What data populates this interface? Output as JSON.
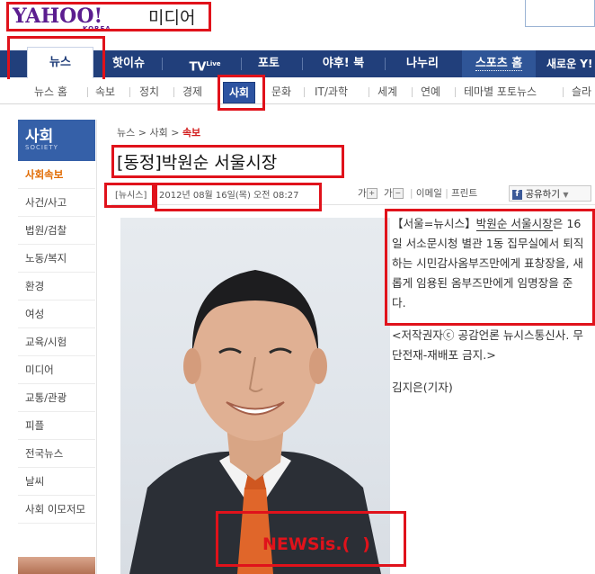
{
  "header": {
    "logo_text": "YAHOO!",
    "logo_sub": "KOREA",
    "section_name": "미디어"
  },
  "main_nav": [
    "뉴스",
    "핫이슈",
    "TV",
    "포토",
    "야후! 북",
    "나누리",
    "스포츠 홈",
    "새로운 Y!"
  ],
  "main_nav_tv_sup": "Live",
  "sub_nav": [
    "뉴스 홈",
    "속보",
    "정치",
    "경제",
    "사회",
    "문화",
    "IT/과학",
    "세계",
    "연예",
    "테마별 포토뉴스",
    "슬라"
  ],
  "sidebar": {
    "title": "사회",
    "subtitle": "SOCIETY",
    "items": [
      "사회속보",
      "사건/사고",
      "법원/검찰",
      "노동/복지",
      "환경",
      "여성",
      "교육/시험",
      "미디어",
      "교통/관광",
      "피플",
      "전국뉴스",
      "날씨",
      "사회 이모저모"
    ]
  },
  "breadcrumb": {
    "items": [
      "뉴스",
      "사회"
    ],
    "current": "속보",
    "separator": ">"
  },
  "article": {
    "title": "[동정]박원순 서울시장",
    "source": "[뉴시스]",
    "date": "2012년 08월 16일(목) 오전 08:27",
    "tools": {
      "font_up": "가",
      "font_down": "가",
      "email": "이메일",
      "print": "프린트",
      "share": "공유하기"
    },
    "body_lead_source": "【서울=뉴시스】",
    "body_lead_name": "박원순 서울시장",
    "body_lead_rest": "은 16일 서소문시청 별관 1동 집무실에서 퇴직하는 시민감사옴부즈만에게 표창장을, 새롭게 임용된 옴부즈만에게 임명장을 준다.",
    "copyright": "<저작권자ⓒ 공감언론 뉴시스통신사. 무단전재-재배포 금지.>",
    "reporter": "김지은(기자)",
    "watermark_1": "NEWS",
    "watermark_2": "is.(",
    "watermark_3": ")"
  },
  "colors": {
    "nav_bg": "#213f7b",
    "highlight_red": "#e0121b",
    "sidebar_header": "#3560a8",
    "active_orange": "#e16a00"
  }
}
